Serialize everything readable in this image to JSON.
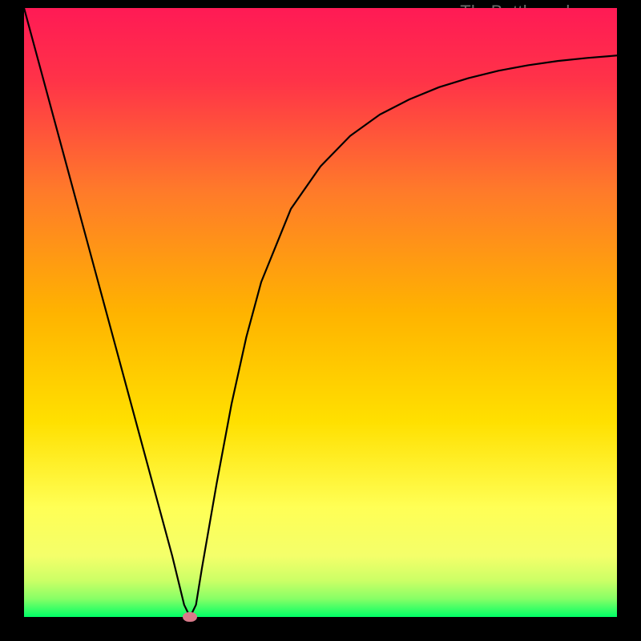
{
  "watermark": "TheBottleneck.com",
  "colors": {
    "bg": "#000000",
    "grad_top": "#ff1a4d",
    "grad_mid1": "#ff6a2a",
    "grad_mid2": "#ffc300",
    "grad_mid3": "#ffff4d",
    "grad_band": "#d9ff66",
    "grad_bottom": "#00ff66",
    "curve": "#000000",
    "marker": "#d97a8a"
  },
  "chart_data": {
    "type": "line",
    "title": "",
    "xlabel": "",
    "ylabel": "",
    "xlim": [
      0,
      100
    ],
    "ylim": [
      0,
      100
    ],
    "annotations": [
      "TheBottleneck.com"
    ],
    "x": [
      0,
      2.5,
      5,
      7.5,
      10,
      12.5,
      15,
      17.5,
      20,
      22.5,
      25,
      26,
      27,
      28,
      29,
      30,
      32.5,
      35,
      37.5,
      40,
      45,
      50,
      55,
      60,
      65,
      70,
      75,
      80,
      85,
      90,
      95,
      100
    ],
    "y": [
      100,
      91,
      82,
      73,
      64,
      55,
      46,
      37,
      28,
      19,
      10,
      6,
      2,
      0,
      2,
      8,
      22,
      35,
      46,
      55,
      67,
      74,
      79,
      82.5,
      85,
      87,
      88.5,
      89.7,
      90.6,
      91.3,
      91.8,
      92.2
    ],
    "legend": [],
    "grid": false,
    "min_point": {
      "x": 28,
      "y": 0
    }
  }
}
